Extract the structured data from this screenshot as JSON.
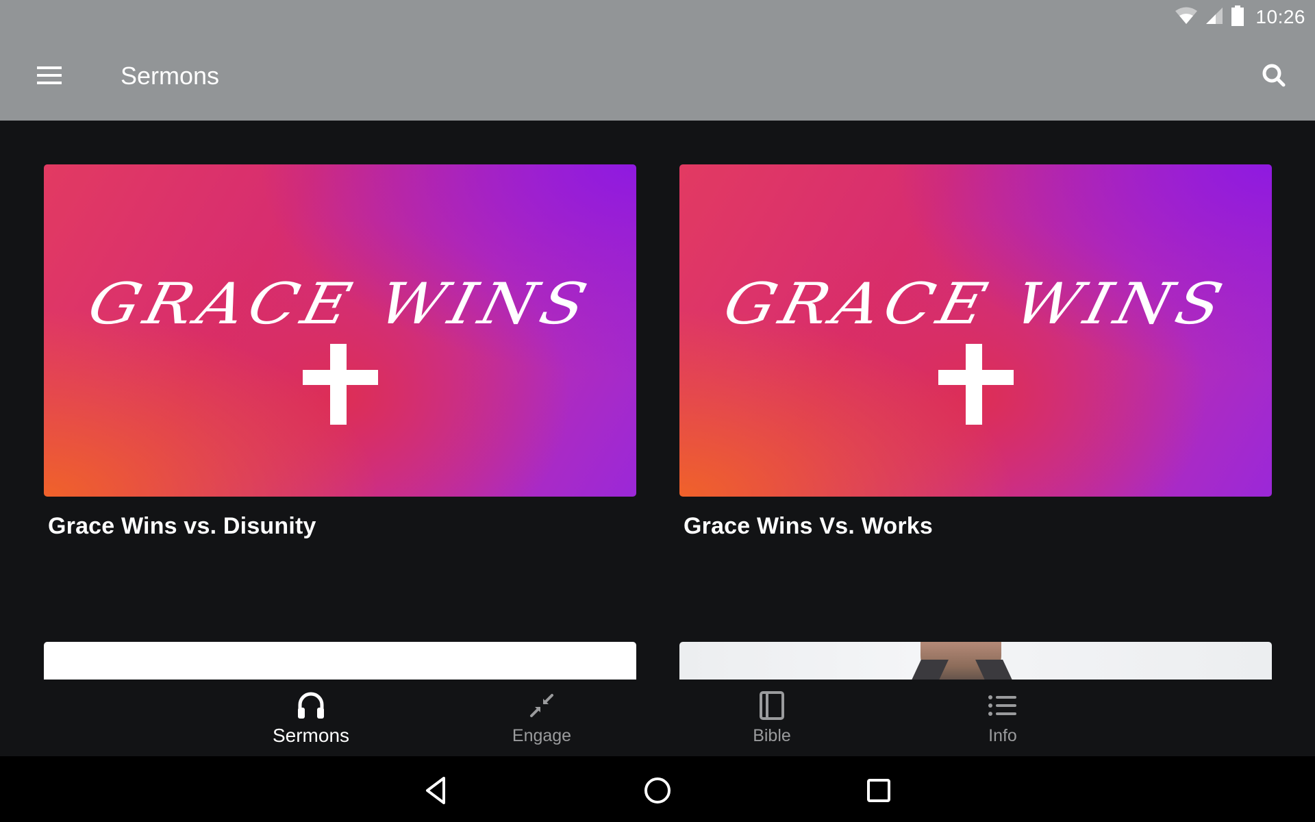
{
  "status_bar": {
    "time": "10:26",
    "icons": [
      "wifi-icon",
      "cell-signal-icon",
      "battery-icon"
    ]
  },
  "app_bar": {
    "title": "Sermons",
    "menu_icon": "hamburger-menu-icon",
    "search_icon": "search-icon"
  },
  "sermons": [
    {
      "title": "Grace Wins vs. Disunity",
      "artwork_text": "GRACE WINS"
    },
    {
      "title": "Grace Wins Vs. Works",
      "artwork_text": "GRACE WINS"
    }
  ],
  "bottom_nav": {
    "items": [
      {
        "label": "Sermons",
        "icon": "headphones-icon",
        "active": true
      },
      {
        "label": "Engage",
        "icon": "arrows-collapse-icon",
        "active": false
      },
      {
        "label": "Bible",
        "icon": "book-icon",
        "active": false
      },
      {
        "label": "Info",
        "icon": "list-icon",
        "active": false
      }
    ]
  },
  "system_nav": {
    "buttons": [
      "back-icon",
      "home-icon",
      "recents-icon"
    ]
  },
  "colors": {
    "app_bar": "#929597",
    "background": "#121315",
    "nav_active": "#ffffff",
    "nav_inactive": "#9a9b9d"
  }
}
